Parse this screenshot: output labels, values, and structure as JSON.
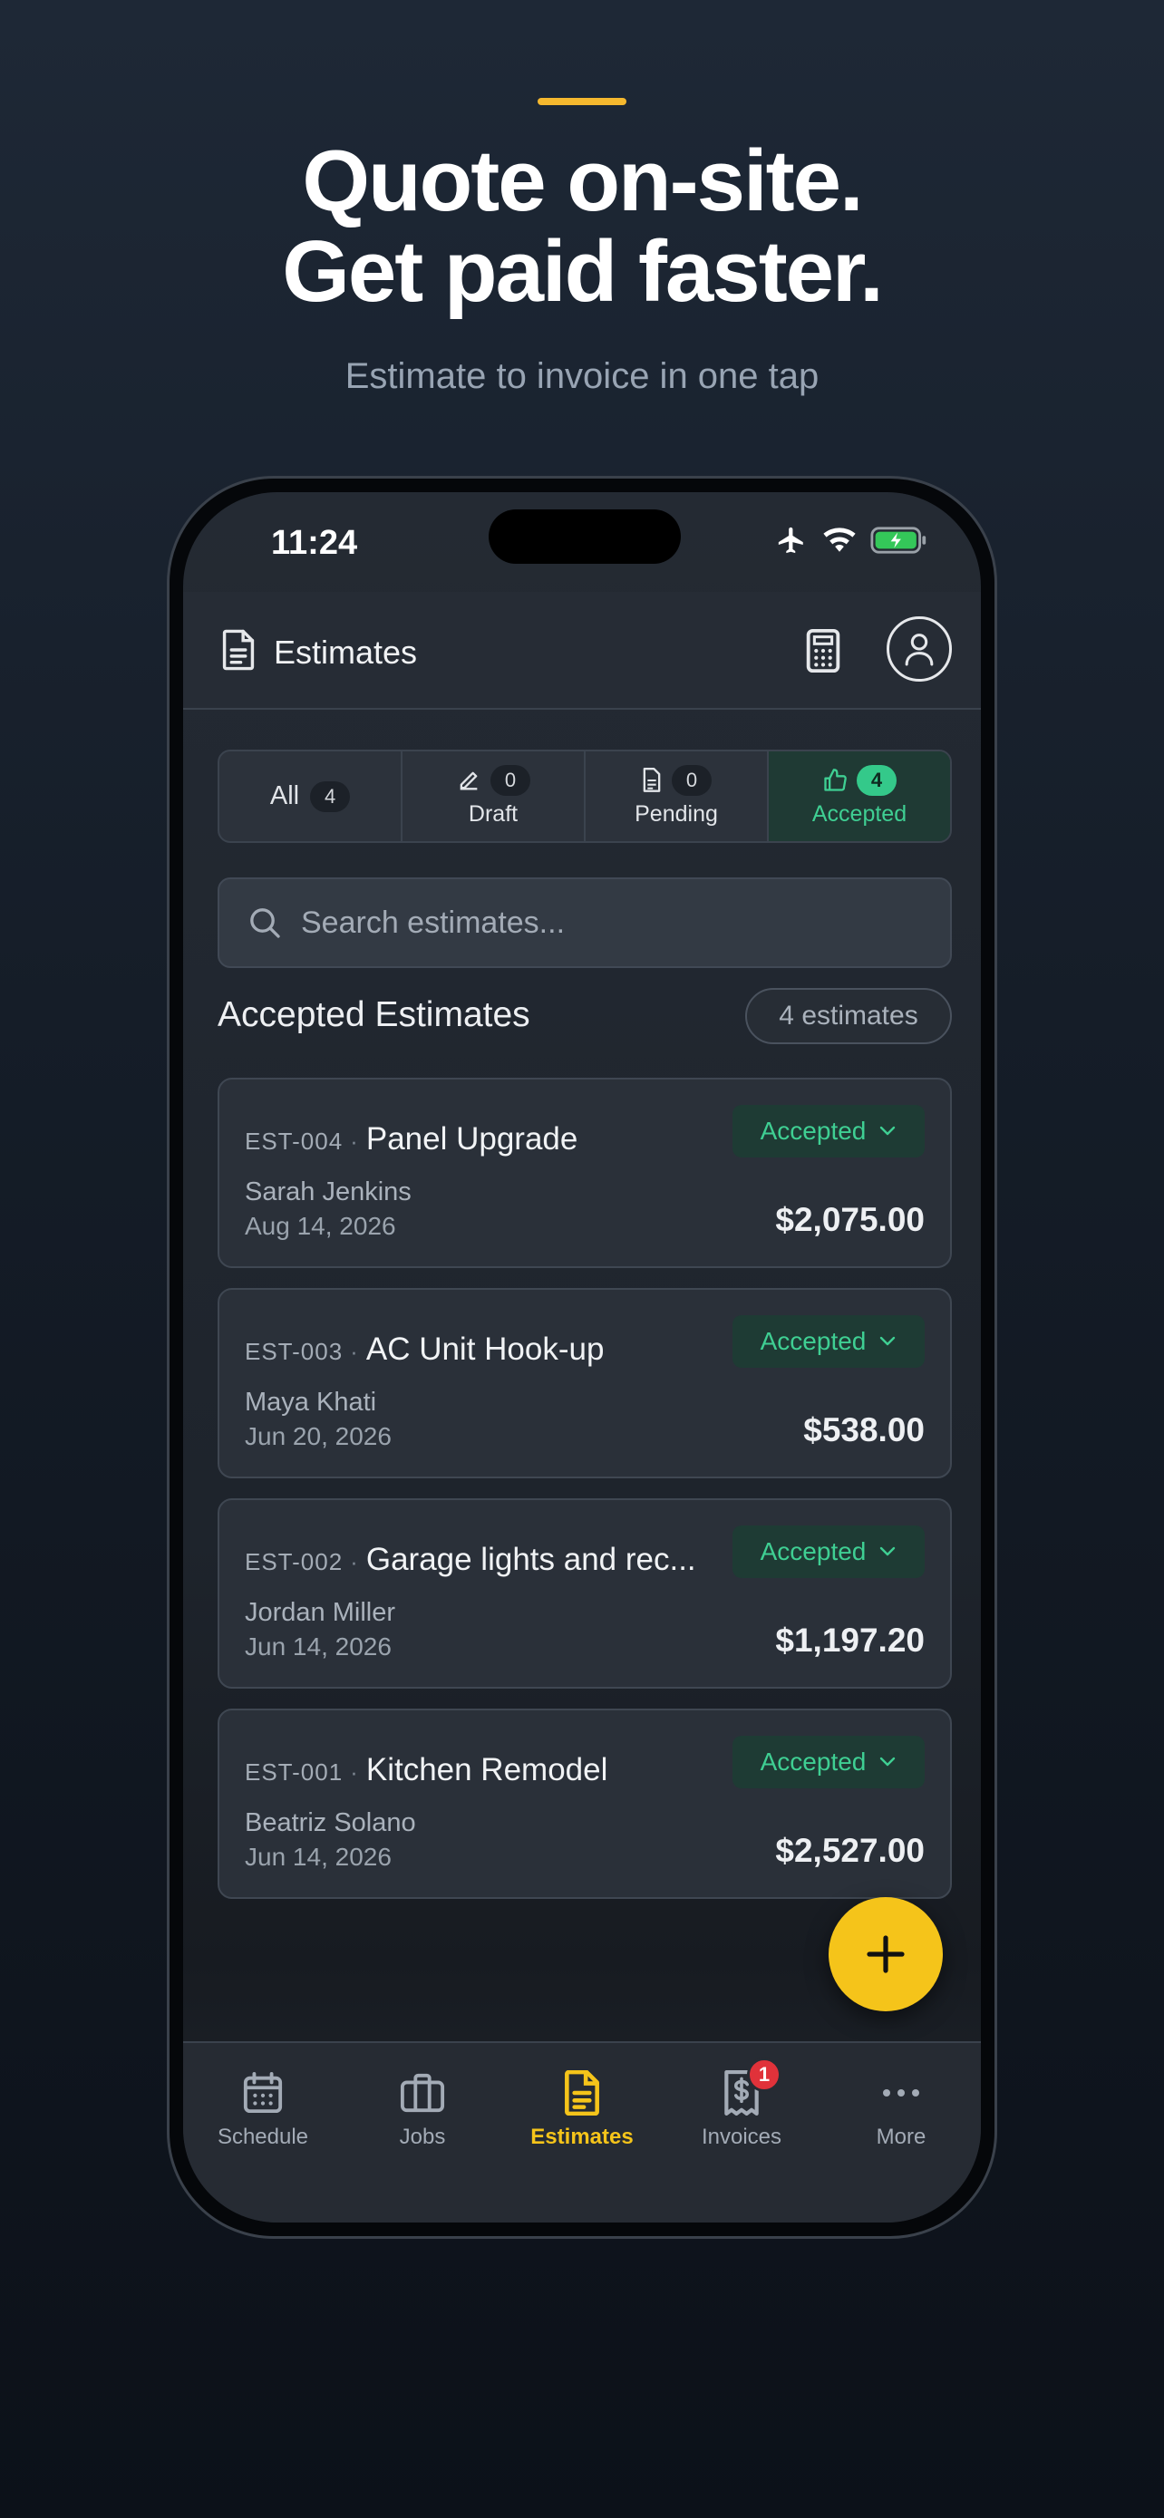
{
  "marketing": {
    "headline_line1": "Quote on-site.",
    "headline_line2": "Get paid faster.",
    "subheadline": "Estimate to invoice in one tap"
  },
  "status_bar": {
    "time": "11:24"
  },
  "app_bar": {
    "title": "Estimates"
  },
  "filter_tabs": [
    {
      "label": "All",
      "count": "4"
    },
    {
      "label": "Draft",
      "count": "0"
    },
    {
      "label": "Pending",
      "count": "0"
    },
    {
      "label": "Accepted",
      "count": "4"
    }
  ],
  "search": {
    "placeholder": "Search estimates..."
  },
  "section": {
    "title": "Accepted Estimates",
    "count_label": "4 estimates"
  },
  "estimates": [
    {
      "number": "EST-004",
      "job": "Panel Upgrade",
      "status": "Accepted",
      "client": "Sarah Jenkins",
      "date": "Aug 14, 2026",
      "amount": "$2,075.00"
    },
    {
      "number": "EST-003",
      "job": "AC Unit Hook-up",
      "status": "Accepted",
      "client": "Maya Khati",
      "date": "Jun 20, 2026",
      "amount": "$538.00"
    },
    {
      "number": "EST-002",
      "job": "Garage lights and rec...",
      "status": "Accepted",
      "client": "Jordan Miller",
      "date": "Jun 14, 2026",
      "amount": "$1,197.20"
    },
    {
      "number": "EST-001",
      "job": "Kitchen Remodel",
      "status": "Accepted",
      "client": "Beatriz Solano",
      "date": "Jun 14, 2026",
      "amount": "$2,527.00"
    }
  ],
  "bottom_nav": [
    {
      "label": "Schedule",
      "icon": "calendar-icon"
    },
    {
      "label": "Jobs",
      "icon": "briefcase-icon"
    },
    {
      "label": "Estimates",
      "icon": "document-icon"
    },
    {
      "label": "Invoices",
      "icon": "invoice-icon",
      "badge": "1"
    },
    {
      "label": "More",
      "icon": "more-icon"
    }
  ],
  "colors": {
    "accent": "#f5c41a",
    "success": "#3fcf93",
    "headline_bar": "#f5b82e",
    "badge_red": "#e0323a"
  }
}
